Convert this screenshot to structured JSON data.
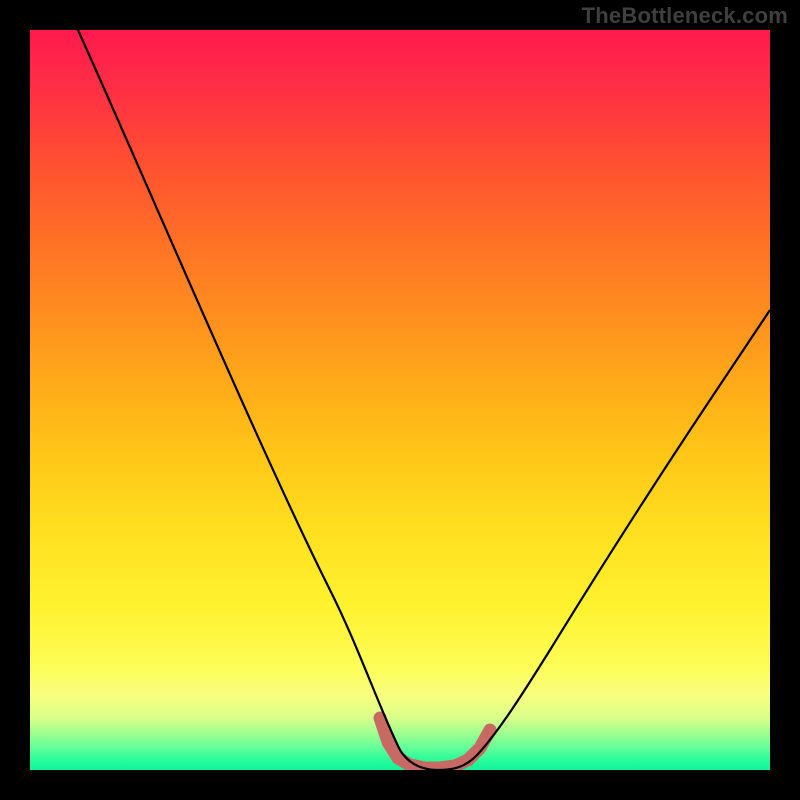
{
  "watermark": "TheBottleneck.com",
  "colors": {
    "background": "#000000",
    "curve": "#000000",
    "valley_accent": "#c86a63",
    "gradient_top": "#ff1a4d",
    "gradient_bottom": "#0df59a"
  },
  "chart_data": {
    "type": "line",
    "title": "",
    "xlabel": "",
    "ylabel": "",
    "xlim": [
      0,
      100
    ],
    "ylim": [
      0,
      100
    ],
    "grid": false,
    "legend": false,
    "series": [
      {
        "name": "bottleneck-curve",
        "x": [
          0,
          5,
          10,
          15,
          20,
          25,
          30,
          35,
          40,
          45,
          48,
          50,
          52,
          55,
          58,
          60,
          62,
          65,
          70,
          75,
          80,
          85,
          90,
          95,
          100
        ],
        "y": [
          100,
          92,
          83,
          74,
          65,
          56,
          47,
          38,
          29,
          18,
          8,
          1,
          0,
          0,
          0,
          1,
          3,
          7,
          14,
          22,
          30,
          38,
          46,
          53,
          60
        ]
      }
    ],
    "annotations": [
      {
        "name": "recommended-range",
        "x_start": 48,
        "x_end": 62,
        "color": "#c86a63"
      }
    ]
  }
}
